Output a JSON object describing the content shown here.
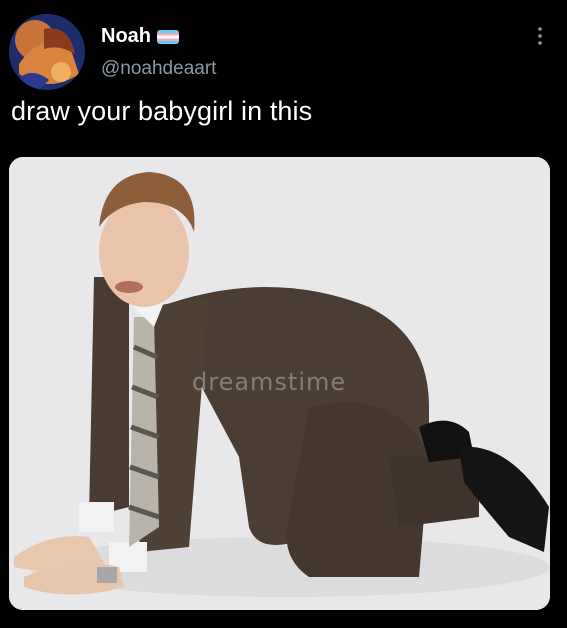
{
  "tweet": {
    "display_name": "Noah",
    "handle": "@noahdeaart",
    "text": "draw your babygirl in this",
    "flag_icon": "transgender-flag-icon",
    "more_icon": "more-options-icon"
  },
  "media": {
    "watermark": "dreamstime",
    "description_icon": "photo"
  },
  "colors": {
    "background": "#000000",
    "handle": "#8b98a5",
    "flag_blue": "#5bcefa",
    "flag_pink": "#f5a9b8",
    "flag_white": "#ffffff"
  }
}
